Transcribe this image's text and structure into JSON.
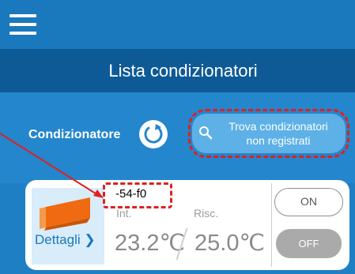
{
  "app": {
    "menu_icon": "hamburger-menu-icon",
    "title": "Lista condizionatori"
  },
  "filter": {
    "label": "Condizionatore",
    "refresh_icon": "refresh-icon",
    "find_button": {
      "line1": "Trova condizionatori",
      "line2": "non registrati",
      "icon": "search-icon"
    }
  },
  "unit": {
    "name": "-54-f0",
    "details_label": "Dettagli",
    "details_icon": "chevron-right-icon",
    "thumb_icon": "air-conditioner-icon",
    "indoor_label": "Int.",
    "mode_label": "Risc.",
    "indoor_temp": "23.2℃",
    "set_temp": "25.0℃",
    "on_label": "ON",
    "off_label": "OFF"
  },
  "colors": {
    "header_blue": "#1a78bd",
    "title_bar": "#0e5a97",
    "filter_bar": "#2486cc",
    "find_button": "#5db1e7",
    "annotation_red": "#e02020",
    "unit_orange": "#ef6a10"
  }
}
